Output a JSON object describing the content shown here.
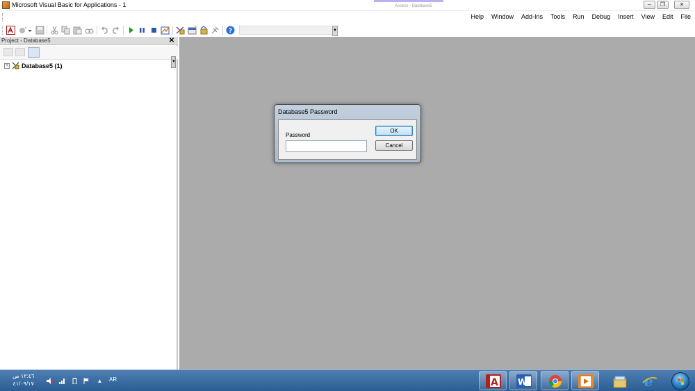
{
  "window": {
    "title": "Microsoft Visual Basic for Applications - 1",
    "background_caption": "Access - Database5"
  },
  "menu": {
    "items": [
      "File",
      "Edit",
      "View",
      "Insert",
      "Debug",
      "Run",
      "Tools",
      "Add-Ins",
      "Window",
      "Help"
    ]
  },
  "toolbar": {
    "icons": [
      "view-access-icon",
      "insert-module-icon",
      "save-icon",
      "cut-icon",
      "copy-icon",
      "paste-icon",
      "find-icon",
      "undo-icon",
      "redo-icon",
      "run-icon",
      "break-icon",
      "reset-icon",
      "design-mode-icon",
      "project-explorer-icon",
      "properties-icon",
      "object-browser-icon",
      "toolbox-icon",
      "help-icon"
    ]
  },
  "project_panel": {
    "title": "Project - Database5",
    "tree": [
      {
        "label": "Database5 (1)",
        "expanded": false
      }
    ]
  },
  "dialog": {
    "title": "Database5 Password",
    "password_label": "Password",
    "password_value": "",
    "ok_label": "OK",
    "cancel_label": "Cancel"
  },
  "taskbar": {
    "time": "١٢:٤٦ ص",
    "date": "٤١/٠٩/١٧",
    "language": "AR",
    "apps": [
      "access-icon",
      "word-icon",
      "chrome-icon",
      "media-player-icon",
      "file-explorer-icon",
      "internet-explorer-icon"
    ]
  },
  "colors": {
    "mdi_background": "#ababab",
    "taskbar": "#2a5d93",
    "dialog_frame": "#b7c6d6"
  }
}
